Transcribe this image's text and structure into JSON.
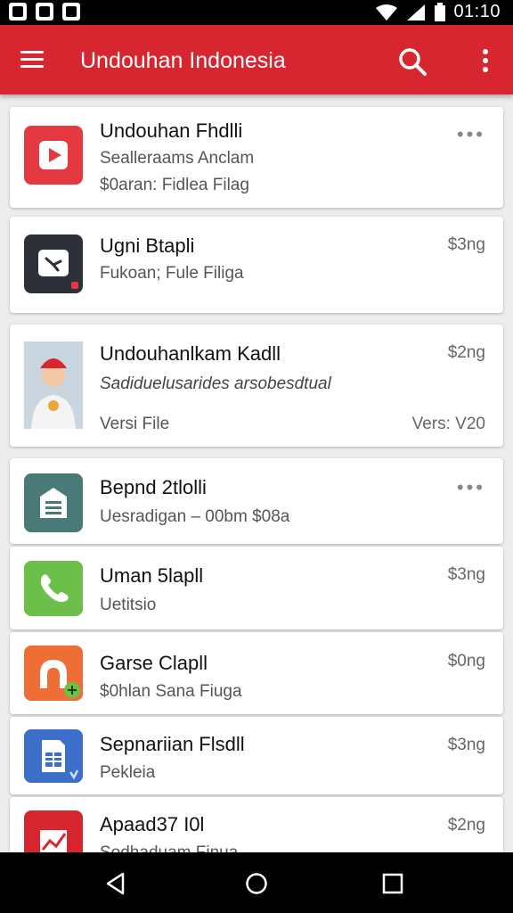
{
  "status_bar": {
    "time": "01:10"
  },
  "app_bar": {
    "title": "Undouhan Indonesia"
  },
  "items": [
    {
      "title": "Undouhan Fhdlli",
      "line1": "Sealleraams Anclam",
      "line2": "$0aran: Fidlea Filag",
      "price": "",
      "has_more_menu": true,
      "icon": "play-icon",
      "icon_color": "#e53941"
    },
    {
      "title": "Ugni Btapli",
      "line1": "Fukoan; Fule Filiga",
      "line2": "",
      "price": "$3ng",
      "has_more_menu": false,
      "icon": "tools-icon",
      "icon_color": "#2d3038"
    },
    {
      "title": "Undouhanlkam Kadll",
      "line1": "Sadiduelusarides arsobesdtual",
      "line2": "Versi File",
      "price": "$2ng",
      "version": "Vers: V20",
      "has_more_menu": false,
      "icon": "avatar-icon",
      "icon_color": "#3d6b8c"
    },
    {
      "title": "Bepnd 2tlolli",
      "line1": "Uesradigan – 00bm $08a",
      "line2": "",
      "price": "",
      "has_more_menu": true,
      "icon": "building-icon",
      "icon_color": "#4a7a78"
    },
    {
      "title": "Uman 5lapll",
      "line1": "Uetitsio",
      "line2": "",
      "price": "$3ng",
      "has_more_menu": false,
      "icon": "phone-icon",
      "icon_color": "#6cc04a"
    },
    {
      "title": "Garse Clapll",
      "line1": "$0hlan Sana Fiuga",
      "line2": "",
      "price": "$0ng",
      "has_more_menu": false,
      "icon": "arch-icon",
      "icon_color": "#ee6e35"
    },
    {
      "title": "Sepnariian Flsdll",
      "line1": "Pekleia",
      "line2": "",
      "price": "$3ng",
      "has_more_menu": false,
      "icon": "document-icon",
      "icon_color": "#3b6fc9"
    },
    {
      "title": "Apaad37 I0l",
      "line1": "Sodhaduam Finua",
      "line2": "",
      "price": "$2ng",
      "has_more_menu": false,
      "icon": "chart-icon",
      "icon_color": "#d7262f"
    }
  ]
}
